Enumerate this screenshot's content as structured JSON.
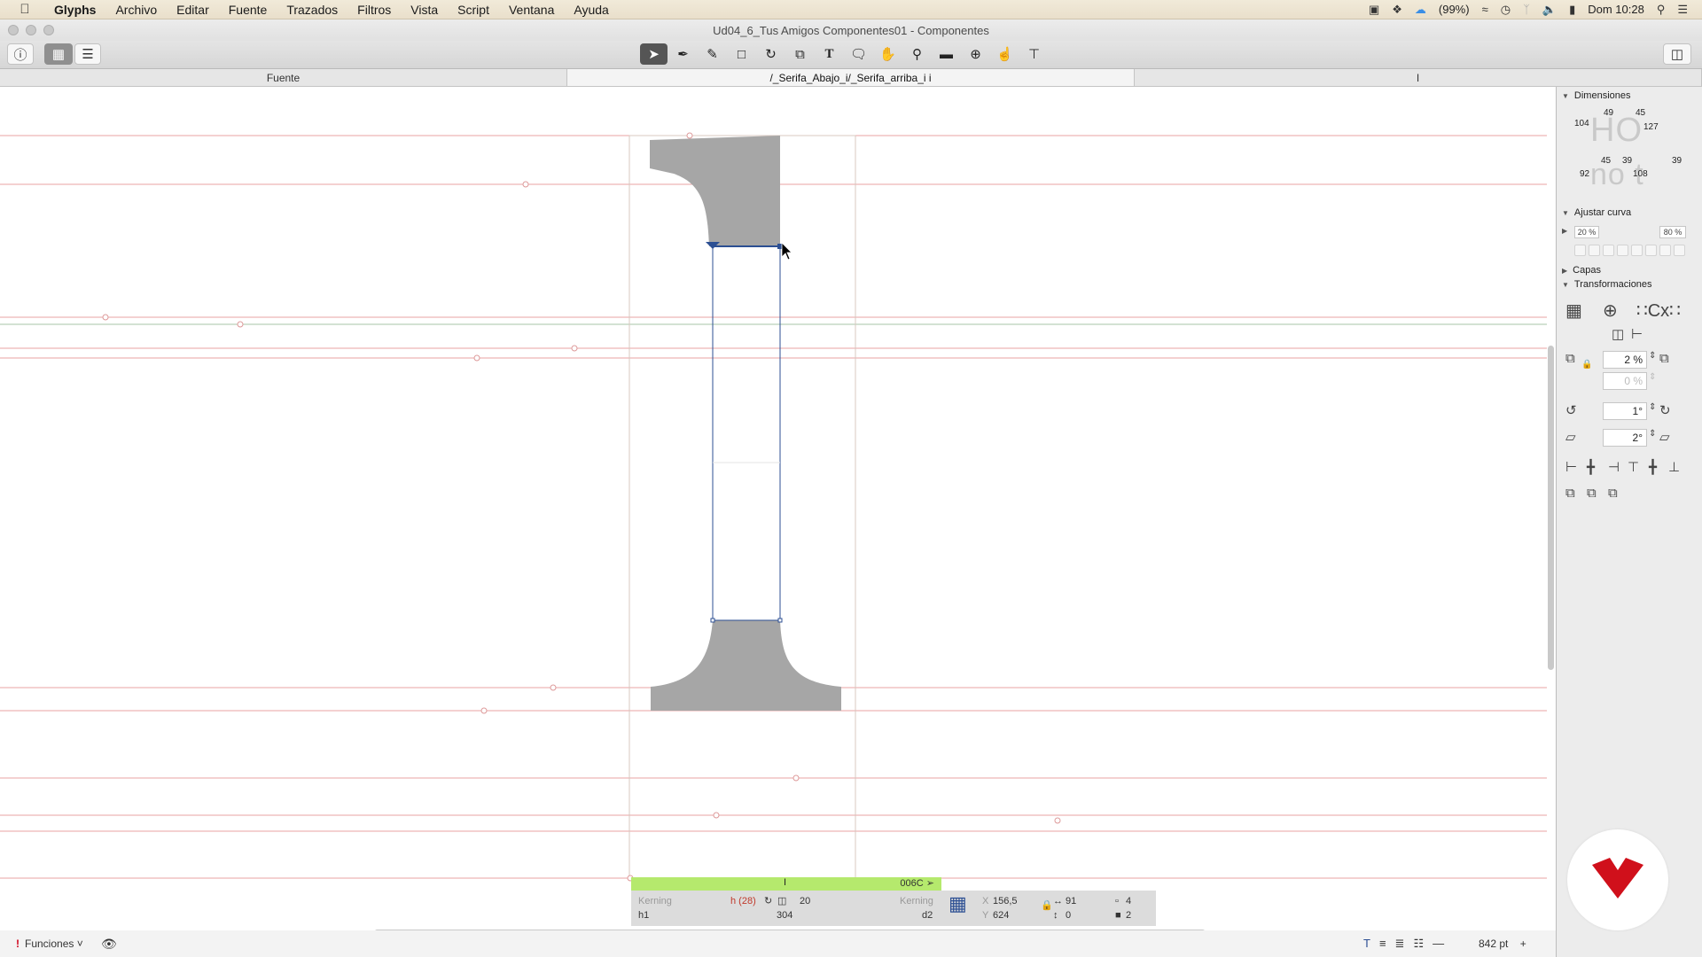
{
  "menubar": {
    "app": "Glyphs",
    "items": [
      "Archivo",
      "Editar",
      "Fuente",
      "Trazados",
      "Filtros",
      "Vista",
      "Script",
      "Ventana",
      "Ayuda"
    ],
    "battery": "(99%)",
    "clock": "Dom 10:28"
  },
  "window": {
    "title": "Ud04_6_Tus Amigos Componentes01 - Componentes"
  },
  "tabs": [
    {
      "label": "Fuente"
    },
    {
      "label": "/_Serifa_Abajo_i/_Serifa_arriba_i i"
    },
    {
      "label": "I"
    }
  ],
  "glyph_tag": {
    "name": "I",
    "code": "006C"
  },
  "infobar": {
    "kerning_left_label": "Kerning",
    "left_group": "h1",
    "left_metric": "h (28)",
    "width_value": "20",
    "advance": "304",
    "kerning_right_label": "Kerning",
    "right_group": "d2",
    "x_label": "X",
    "x_value": "156,5",
    "y_label": "Y",
    "y_value": "624",
    "w_value": "91",
    "h_value": "0",
    "nodes_count": "4",
    "paths_count": "2"
  },
  "statusbar": {
    "functions": "Funciones",
    "zoom": "842 pt"
  },
  "panel": {
    "dimensiones": {
      "title": "Dimensiones",
      "values_top": [
        "104",
        "49",
        "45",
        "127"
      ],
      "values_bottom": [
        "92",
        "45",
        "39",
        "108",
        "39"
      ],
      "sample_top": "HO",
      "sample_bottom": "no t"
    },
    "ajustar_curva": {
      "title": "Ajustar curva",
      "min": "20 %",
      "max": "80 %"
    },
    "capas": {
      "title": "Capas"
    },
    "transformaciones": {
      "title": "Transformaciones",
      "scale": "2 %",
      "scale_v": "0 %",
      "rotate": "1°",
      "slant": "2°"
    }
  },
  "colors": {
    "accent_green": "#b5e96d",
    "guide_red": "#e8a3a3",
    "glyph_fill": "#a6a6a6",
    "selection_blue": "#2c4f93",
    "logo_red": "#d0101b"
  }
}
